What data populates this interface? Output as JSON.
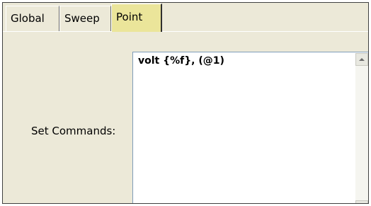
{
  "tabs": [
    {
      "label": "Global",
      "active": false
    },
    {
      "label": "Sweep",
      "active": false
    },
    {
      "label": "Point",
      "active": true
    }
  ],
  "form": {
    "set_commands_label": "Set Commands:",
    "set_commands_value": "volt {%f}, (@1)"
  },
  "colors": {
    "active_tab": "#ebe59a",
    "panel_bg": "#ece9d8"
  }
}
